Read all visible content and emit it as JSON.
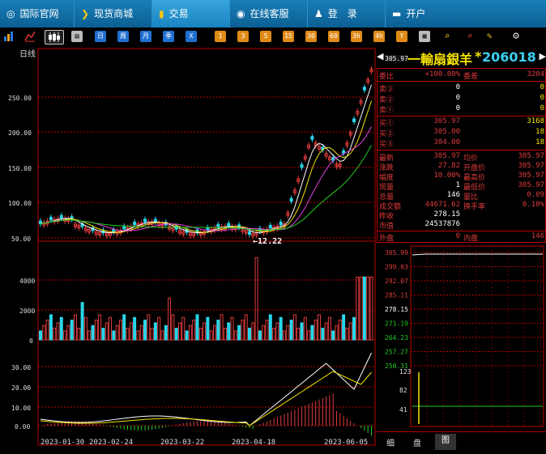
{
  "nav": {
    "items": [
      {
        "label": "国际官网",
        "icon": "globe-icon"
      },
      {
        "label": "现货商城",
        "icon": "shop-icon"
      },
      {
        "label": "交易",
        "icon": "trade-icon"
      },
      {
        "label": "在线客服",
        "icon": "chat-icon"
      },
      {
        "label": "登　录",
        "icon": "user-icon"
      },
      {
        "label": "开户",
        "icon": "card-icon"
      }
    ]
  },
  "toolbar": {
    "period_buttons": [
      "1",
      "3",
      "5",
      "15",
      "30",
      "60",
      "3h",
      "4h",
      "Y"
    ],
    "blue_buttons": [
      "日",
      "周",
      "月",
      "季",
      "X"
    ]
  },
  "chart": {
    "period_label": "日线",
    "price_ticks": [
      "250.00",
      "200.00",
      "150.00",
      "100.00",
      "50.00"
    ],
    "volume_ticks": [
      "4000",
      "2000",
      "0"
    ],
    "macd_ticks": [
      "30.00",
      "20.00",
      "10.00",
      "0.00"
    ],
    "date_labels": [
      "2023-01-30",
      "2023-02-24",
      "2023-03-22",
      "2023-04-18",
      "2023-06-05"
    ],
    "low_marker": "12.22",
    "high_marker": "305.97"
  },
  "stock": {
    "name": "一輸扇銀羊",
    "star": "*",
    "code": "206018",
    "weibi_label": "委比",
    "weibi_value": "+100.00%",
    "weicha_label": "委差",
    "weicha_value": "3204",
    "asks": [
      {
        "label": "卖③",
        "price": "0",
        "vol": "0"
      },
      {
        "label": "卖②",
        "price": "0",
        "vol": "0"
      },
      {
        "label": "卖①",
        "price": "0",
        "vol": "0"
      }
    ],
    "bids": [
      {
        "label": "买①",
        "price": "305.97",
        "vol": "3168"
      },
      {
        "label": "买②",
        "price": "305.00",
        "vol": "18"
      },
      {
        "label": "买③",
        "price": "304.00",
        "vol": "18"
      }
    ],
    "stats": [
      {
        "l1": "最新",
        "v1": "305.97",
        "l2": "均价",
        "v2": "305.97"
      },
      {
        "l1": "涨跌",
        "v1": "27.82",
        "l2": "开盘价",
        "v2": "305.97"
      },
      {
        "l1": "幅度",
        "v1": "10.00%",
        "l2": "最高价",
        "v2": "305.97"
      },
      {
        "l1": "现量",
        "v1": "1",
        "l2": "最低价",
        "v2": "305.97"
      },
      {
        "l1": "总量",
        "v1": "146",
        "l2": "量比",
        "v2": "0.09"
      },
      {
        "l1": "成交额",
        "v1": "44671.62",
        "l2": "换手率",
        "v2": "0.10%"
      },
      {
        "l1": "昨收",
        "v1": "278.15",
        "l2": "",
        "v2": ""
      },
      {
        "l1": "市值",
        "v1": "24537876",
        "l2": "",
        "v2": ""
      }
    ],
    "waipan_label": "外盘",
    "waipan_value": "0",
    "neipan_label": "内盘",
    "neipan_value": "146"
  },
  "intraday": {
    "price_ticks": [
      "305.99",
      "299.03",
      "292.07",
      "285.11",
      "278.15",
      "271.19",
      "264.23",
      "257.27",
      "250.31"
    ],
    "vol_ticks": [
      "123",
      "82",
      "41"
    ]
  },
  "bottom_tabs": [
    "细",
    "盘",
    "图"
  ]
}
